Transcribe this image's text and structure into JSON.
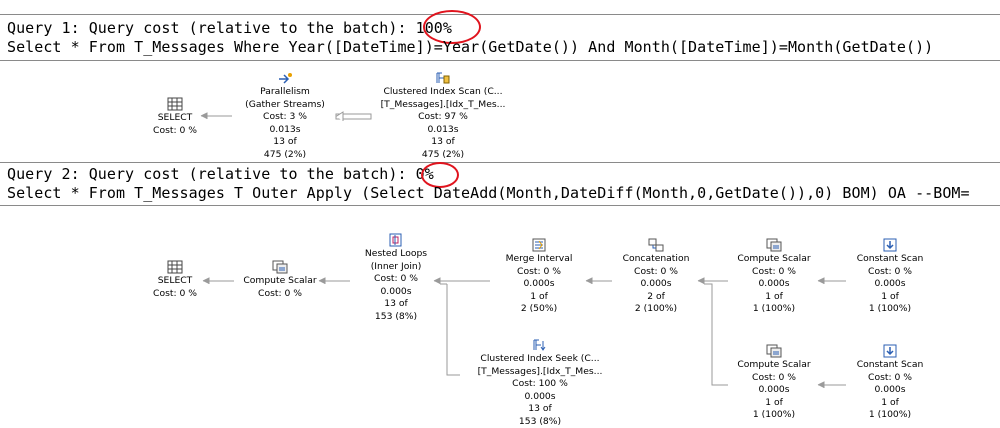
{
  "query1": {
    "header": "Query 1: Query cost (relative to the batch): 100%",
    "sql": "Select * From T_Messages Where Year([DateTime])=Year(GetDate()) And Month([DateTime])=Month(GetDate())",
    "nodes": {
      "select": {
        "line1": "SELECT",
        "line2": "Cost: 0 %"
      },
      "parallelism": {
        "line1": "Parallelism",
        "line2": "(Gather Streams)",
        "line3": "Cost: 3 %",
        "line4": "0.013s",
        "line5": "13 of",
        "line6": "475 (2%)"
      },
      "cis": {
        "line1": "Clustered Index Scan (C...",
        "line2": "[T_Messages].[Idx_T_Mes...",
        "line3": "Cost: 97 %",
        "line4": "0.013s",
        "line5": "13 of",
        "line6": "475 (2%)"
      }
    }
  },
  "query2": {
    "header": "Query 2: Query cost (relative to the batch): 0%",
    "sql": "Select * From T_Messages T Outer Apply (Select DateAdd(Month,DateDiff(Month,0,GetDate()),0) BOM) OA --BOM=",
    "nodes": {
      "select": {
        "line1": "SELECT",
        "line2": "Cost: 0 %"
      },
      "compute": {
        "line1": "Compute Scalar",
        "line2": "Cost: 0 %"
      },
      "nested": {
        "line1": "Nested Loops",
        "line2": "(Inner Join)",
        "line3": "Cost: 0 %",
        "line4": "0.000s",
        "line5": "13 of",
        "line6": "153 (8%)"
      },
      "merge": {
        "line1": "Merge Interval",
        "line2": "Cost: 0 %",
        "line3": "0.000s",
        "line4": "1 of",
        "line5": "2 (50%)"
      },
      "concat": {
        "line1": "Concatenation",
        "line2": "Cost: 0 %",
        "line3": "0.000s",
        "line4": "2 of",
        "line5": "2 (100%)"
      },
      "cs1": {
        "line1": "Compute Scalar",
        "line2": "Cost: 0 %",
        "line3": "0.000s",
        "line4": "1 of",
        "line5": "1 (100%)"
      },
      "const1": {
        "line1": "Constant Scan",
        "line2": "Cost: 0 %",
        "line3": "0.000s",
        "line4": "1 of",
        "line5": "1 (100%)"
      },
      "cs2": {
        "line1": "Compute Scalar",
        "line2": "Cost: 0 %",
        "line3": "0.000s",
        "line4": "1 of",
        "line5": "1 (100%)"
      },
      "const2": {
        "line1": "Constant Scan",
        "line2": "Cost: 0 %",
        "line3": "0.000s",
        "line4": "1 of",
        "line5": "1 (100%)"
      },
      "seek": {
        "line1": "Clustered Index Seek (C...",
        "line2": "[T_Messages].[Idx_T_Mes...",
        "line3": "Cost: 100 %",
        "line4": "0.000s",
        "line5": "13 of",
        "line6": "153 (8%)"
      }
    }
  },
  "colors": {
    "highlight": "#e0141e",
    "separator": "#8a8a8a",
    "connector": "#9a9a9a",
    "icon_blue": "#2b5fb3"
  }
}
